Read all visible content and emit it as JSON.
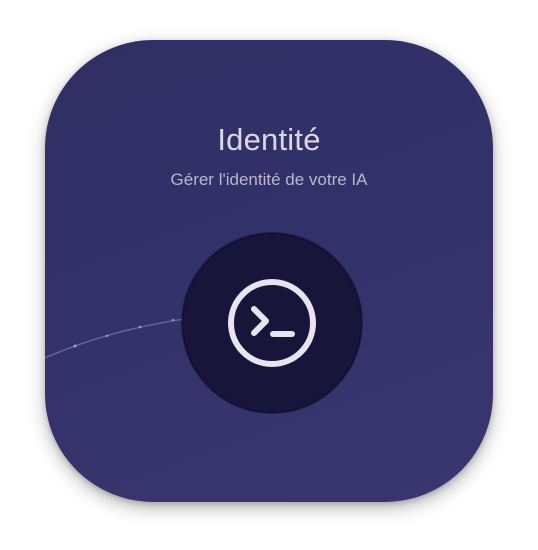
{
  "card": {
    "title": "Identité",
    "subtitle": "Gérer l'identité de votre IA",
    "icon": "terminal-icon"
  },
  "colors": {
    "card_background": "#33316a",
    "button_background": "#17153a",
    "icon_color": "#e6e4ef",
    "title_color": "#d9d7e6",
    "subtitle_color": "#b9b7cc"
  }
}
